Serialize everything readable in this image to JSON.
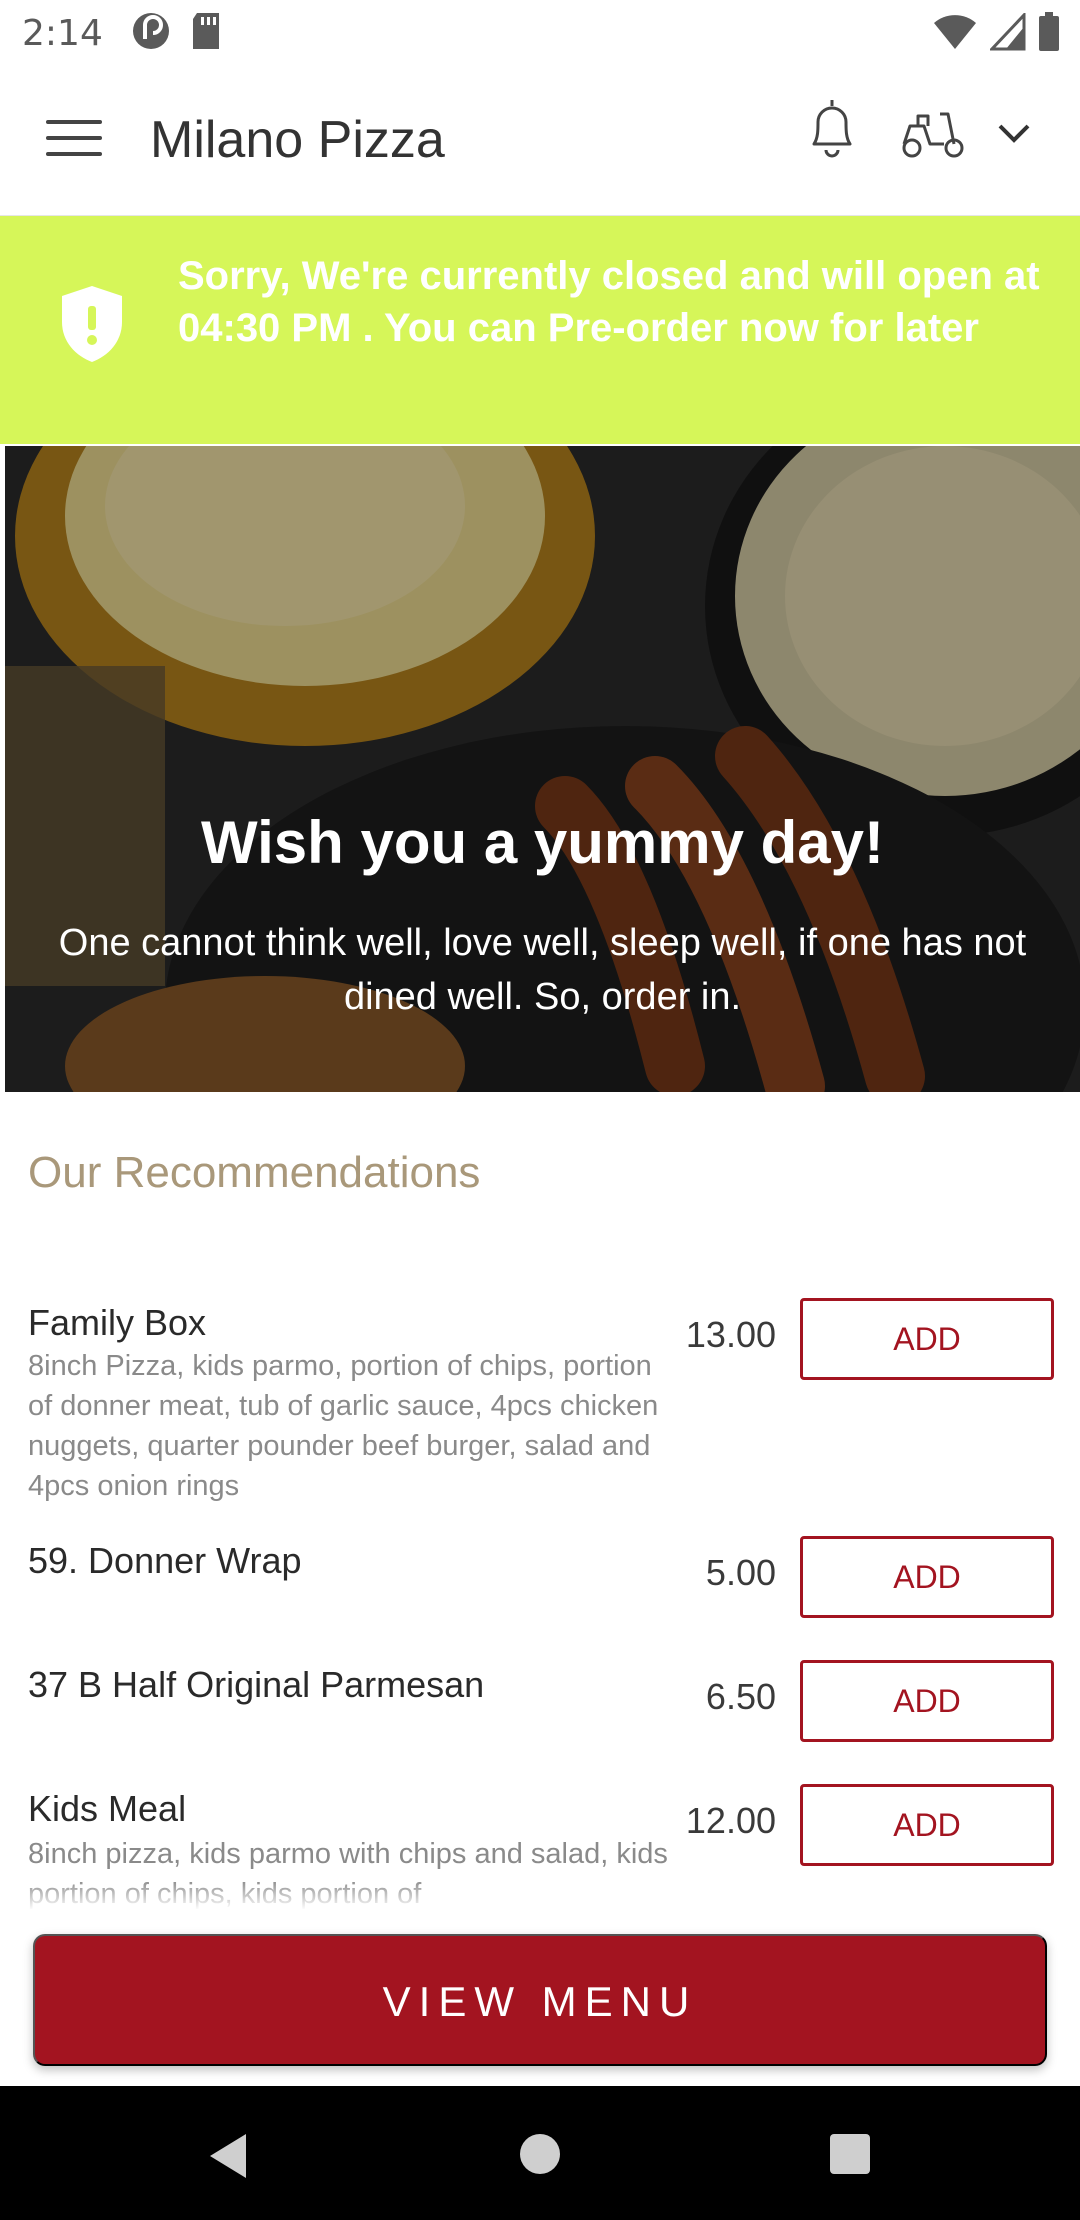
{
  "status_bar": {
    "time": "2:14",
    "icons": [
      "pocket-casts-icon",
      "sd-card-icon",
      "wifi-icon",
      "signal-icon",
      "battery-icon"
    ]
  },
  "app_bar": {
    "title": "Milano Pizza",
    "icons": [
      "menu-icon",
      "bell-icon",
      "scooter-icon",
      "chevron-down-icon"
    ]
  },
  "banner": {
    "text": "Sorry, We're currently closed and will open at 04:30 PM . You can Pre-order now for later",
    "background": "#d6f659"
  },
  "hero": {
    "title": "Wish you a yummy day!",
    "subtitle": "One cannot think well, love well, sleep well, if one has not dined well. So, order in."
  },
  "recommendations": {
    "heading": "Our Recommendations",
    "add_label": "ADD",
    "items": [
      {
        "name": "Family Box",
        "description": "8inch Pizza, kids parmo, portion of chips, portion of donner meat, tub of garlic sauce, 4pcs chicken nuggets, quarter pounder beef burger, salad and 4pcs onion rings",
        "price": "13.00"
      },
      {
        "name": "59. Donner Wrap",
        "description": "",
        "price": "5.00"
      },
      {
        "name": "37 B Half Original Parmesan",
        "description": "",
        "price": "6.50"
      },
      {
        "name": "Kids Meal",
        "description": "8inch pizza, kids parmo with chips and salad, kids portion of chips, kids portion of",
        "price": "12.00"
      }
    ]
  },
  "view_menu_label": "VIEW MENU",
  "colors": {
    "accent": "#a31420",
    "heading": "#a9987a",
    "banner": "#d6f659"
  }
}
